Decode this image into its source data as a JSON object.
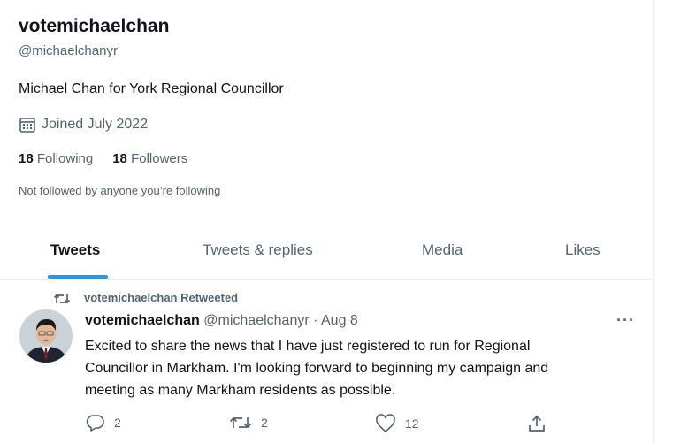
{
  "profile": {
    "display_name": "votemichaelchan",
    "handle": "@michaelchanyr",
    "bio": "Michael Chan for York Regional Councillor",
    "joined": "Joined July 2022",
    "following_count": "18",
    "following_label": " Following",
    "followers_count": "18",
    "followers_label": " Followers",
    "not_followed": "Not followed by anyone you’re following"
  },
  "tabs": [
    "Tweets",
    "Tweets & replies",
    "Media",
    "Likes"
  ],
  "tweet": {
    "retweet_label": "votemichaelchan Retweeted",
    "author_name": "votemichaelchan",
    "author_meta": " @michaelchanyr · Aug 8",
    "text_lines": [
      "Excited to share the news that I have just registered to run for Regional",
      "Councillor in Markham.  I'm looking forward to beginning my campaign and",
      "meeting as many Markham residents as possible."
    ],
    "reply_count": "2",
    "retweet_count": "2",
    "like_count": "12"
  },
  "icons": {
    "calendar": "calendar-icon",
    "retweet": "retweet-icon",
    "reply": "reply-icon",
    "like": "heart-icon",
    "share": "share-icon",
    "more": "more-icon"
  },
  "colors": {
    "accent": "#1d9bf0",
    "secondary_text": "#536471",
    "primary_text": "#0f1419"
  }
}
